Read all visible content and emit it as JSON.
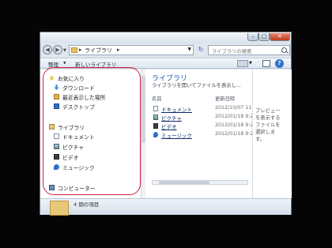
{
  "address": {
    "crumb": "ライブラリ",
    "sep": "▸"
  },
  "search": {
    "placeholder": "ライブラリの検索"
  },
  "toolbar": {
    "organize": "整理",
    "new_library": "新しいライブラリ",
    "help": "?"
  },
  "nav": {
    "favorites": "お気に入り",
    "fav_items": [
      "ダウンロード",
      "最近表示した場所",
      "デスクトップ"
    ],
    "libraries": "ライブラリ",
    "lib_items": [
      "ドキュメント",
      "ピクチャ",
      "ビデオ",
      "ミュージック"
    ],
    "computer": "コンピューター"
  },
  "main": {
    "title": "ライブラリ",
    "subtitle": "ライブラリを開いてファイルを表示し...",
    "col_name": "名前",
    "col_date": "更新日時",
    "rows": [
      {
        "name": "ドキュメント",
        "date": "2012/10/07 11:46",
        "icon": "documents-icon"
      },
      {
        "name": "ピクチャ",
        "date": "2012/01/18 9:27",
        "icon": "pictures-icon"
      },
      {
        "name": "ビデオ",
        "date": "2012/01/18 9:27",
        "icon": "videos-icon"
      },
      {
        "name": "ミュージック",
        "date": "2012/01/18 9:27",
        "icon": "music-icon"
      }
    ]
  },
  "preview": {
    "line1": "プレビュー",
    "line2": "を表示する",
    "line3": "ファイルを",
    "line4": "選択しま",
    "line5": "す。"
  },
  "details": {
    "text": "4 個の項目"
  },
  "colors": {
    "accent": "#1e5aa8",
    "annotation": "#d0203a",
    "close": "#c0381d"
  }
}
